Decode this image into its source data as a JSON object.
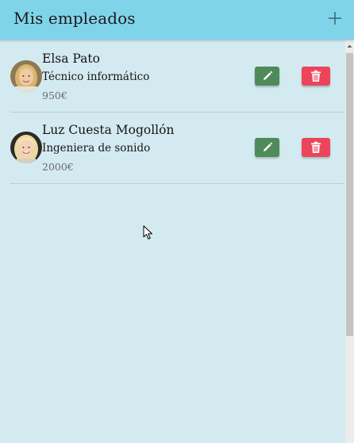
{
  "app": {
    "title": "Mis empleados",
    "add_icon": "plus-icon",
    "colors": {
      "toolbar": "#80d4ea",
      "background": "#d3eaf0",
      "edit": "#4e8a5a",
      "delete": "#ec445a"
    }
  },
  "employees": [
    {
      "name": "Elsa Pato",
      "role": "Técnico informático",
      "salary": "950€",
      "avatar": "avatar-photo",
      "edit_icon": "pencil-icon",
      "delete_icon": "trash-icon"
    },
    {
      "name": "Luz Cuesta Mogollón",
      "role": "Ingeniera de sonido",
      "salary": "2000€",
      "avatar": "avatar-photo",
      "edit_icon": "pencil-icon",
      "delete_icon": "trash-icon"
    }
  ]
}
